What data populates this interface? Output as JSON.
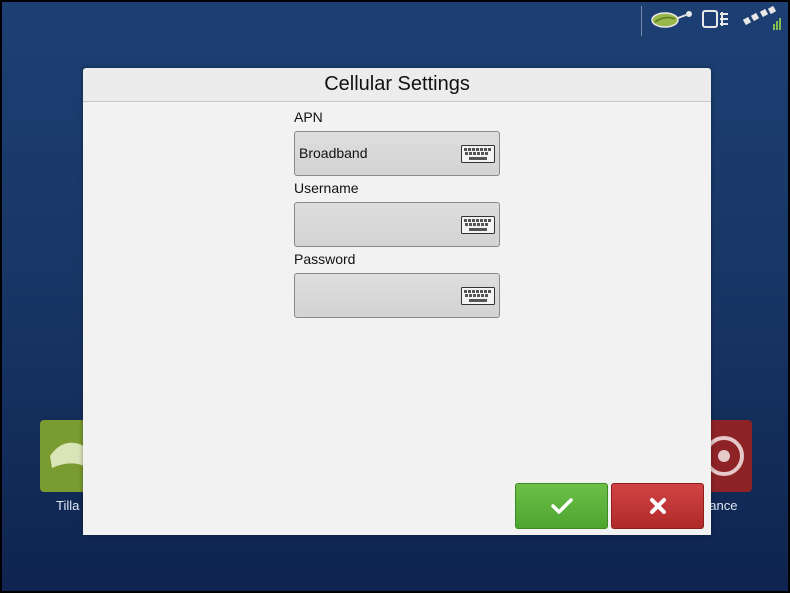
{
  "dialog": {
    "title": "Cellular Settings",
    "fields": [
      {
        "label": "APN",
        "value": "Broadband",
        "icon": "keyboard-icon"
      },
      {
        "label": "Username",
        "value": "",
        "icon": "keyboard-icon"
      },
      {
        "label": "Password",
        "value": "",
        "icon": "keyboard-icon"
      }
    ],
    "buttons": {
      "accept_icon": "checkmark-icon",
      "cancel_icon": "x-icon"
    }
  },
  "background": {
    "tiles": [
      {
        "label": "Tilla",
        "color": "#7a9b2f"
      },
      {
        "label": "dance",
        "color": "#8e2327"
      }
    ]
  },
  "status_icons": [
    "field-leaf-icon",
    "device-connection-icon",
    "satellite-signal-icon"
  ]
}
